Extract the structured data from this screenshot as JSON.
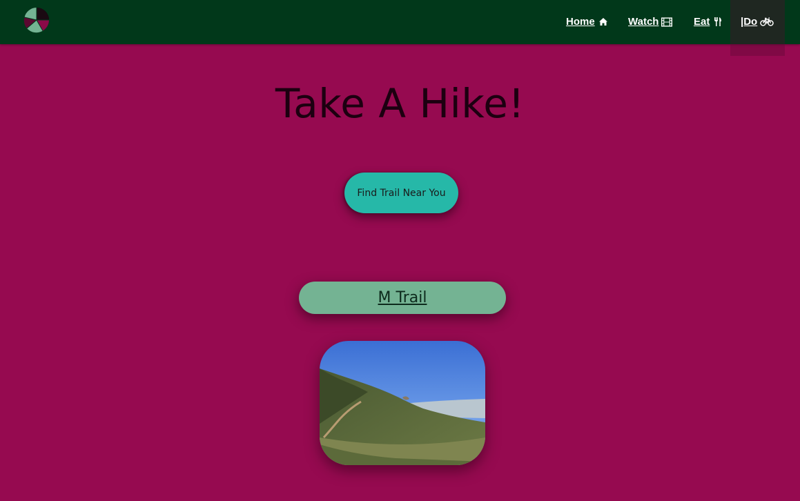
{
  "colors": {
    "page_background": "#960a50",
    "navbar_background": "#01381a",
    "button_background": "#26b8a8",
    "trail_pill_background": "#74b393",
    "title_color": "#1c0010"
  },
  "logo": {
    "icon": "pie-logo-icon"
  },
  "nav": {
    "items": [
      {
        "label": "Home",
        "icon": "home-icon"
      },
      {
        "label": "Watch",
        "icon": "film-icon"
      },
      {
        "label": "Eat",
        "icon": "utensils-icon"
      },
      {
        "label": "|Do",
        "icon": "bicycle-icon"
      }
    ]
  },
  "main": {
    "title": "Take A Hike!",
    "find_button_label": "Find Trail Near You",
    "trail": {
      "name": "M Trail",
      "image_icon": "trail-photo"
    }
  }
}
